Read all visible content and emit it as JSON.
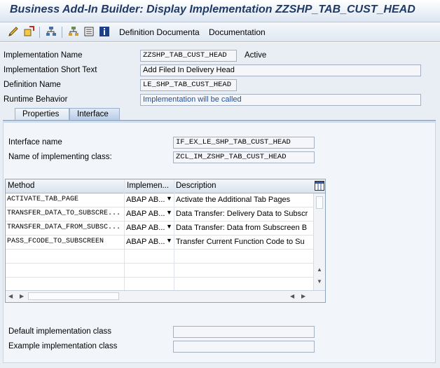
{
  "title": "Business Add-In Builder: Display Implementation ZZSHP_TAB_CUST_HEAD",
  "toolbar": {
    "icons": [
      "change-icon",
      "activate-icon",
      "hierarchy-icon",
      "structure-icon",
      "list-icon",
      "info-icon"
    ],
    "definition_documentation": "Definition Documenta",
    "documentation": "Documentation"
  },
  "header": {
    "impl_name_label": "Implementation Name",
    "impl_name": "ZZSHP_TAB_CUST_HEAD",
    "status": "Active",
    "short_text_label": "Implementation Short Text",
    "short_text": "Add Filed In Delivery Head",
    "def_name_label": "Definition Name",
    "def_name": "LE_SHP_TAB_CUST_HEAD",
    "runtime_label": "Runtime Behavior",
    "runtime": "Implementation will be called"
  },
  "tabs": {
    "properties": "Properties",
    "interface": "Interface"
  },
  "interface": {
    "name_label": "Interface name",
    "name": "IF_EX_LE_SHP_TAB_CUST_HEAD",
    "class_label": "Name of implementing class:",
    "class": "ZCL_IM_ZSHP_TAB_CUST_HEAD"
  },
  "table": {
    "columns": {
      "method": "Method",
      "implementation": "Implemen...",
      "description": "Description"
    },
    "rows": [
      {
        "method": "ACTIVATE_TAB_PAGE",
        "impl": "ABAP AB...",
        "desc": "Activate the Additional Tab Pages"
      },
      {
        "method": "TRANSFER_DATA_TO_SUBSCRE...",
        "impl": "ABAP AB...",
        "desc": "Data Transfer: Delivery Data to Subscr"
      },
      {
        "method": "TRANSFER_DATA_FROM_SUBSC...",
        "impl": "ABAP AB...",
        "desc": "Data Transfer: Data from Subscreen B"
      },
      {
        "method": "PASS_FCODE_TO_SUBSCREEN",
        "impl": "ABAP AB...",
        "desc": "Transfer Current Function Code to Su"
      }
    ]
  },
  "footer": {
    "default_label": "Default implementation class",
    "example_label": "Example implementation class"
  }
}
